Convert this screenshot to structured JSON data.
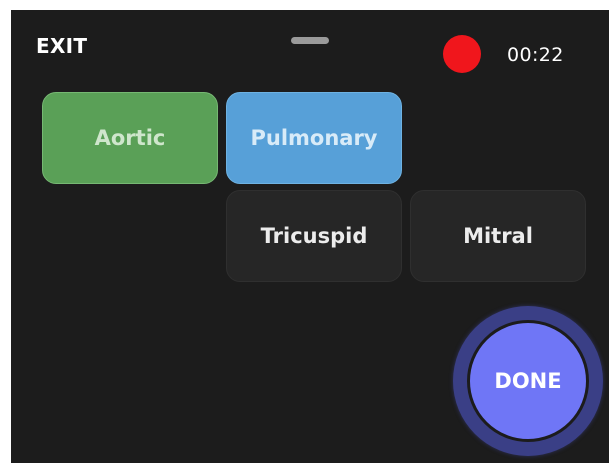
{
  "header": {
    "exit_label": "EXIT",
    "timer": "00:22",
    "recording_color": "#f0161c"
  },
  "valves": {
    "items": [
      {
        "label": "Aortic",
        "state": "selected",
        "color": "#5aa057"
      },
      {
        "label": "Pulmonary",
        "state": "active",
        "color": "#57a0d8"
      },
      {
        "label": "Tricuspid",
        "state": "default",
        "color": "#262626"
      },
      {
        "label": "Mitral",
        "state": "default",
        "color": "#262626"
      }
    ]
  },
  "footer": {
    "done_label": "DONE",
    "done_color": "#6f76f6"
  },
  "icons": [
    "recording-indicator-icon",
    "drag-handle-icon"
  ]
}
